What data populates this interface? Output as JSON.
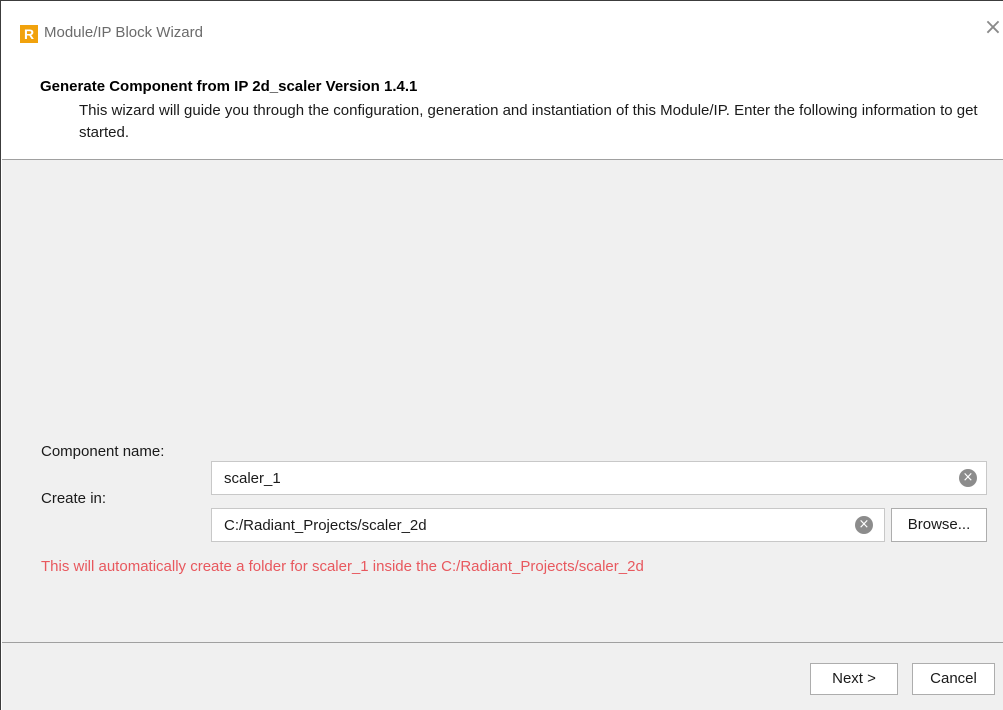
{
  "window": {
    "title": "Module/IP Block Wizard",
    "app_icon_letter": "R",
    "close_glyph": "×"
  },
  "header": {
    "title": "Generate Component from IP 2d_scaler Version 1.4.1",
    "description": "This wizard will guide you through the configuration, generation and instantiation of this Module/IP. Enter the following information to get started."
  },
  "form": {
    "component_name_label": "Component name:",
    "component_name_value": "scaler_1",
    "create_in_label": "Create in:",
    "create_in_value": "C:/Radiant_Projects/scaler_2d",
    "browse_label": "Browse...",
    "clear_glyph": "×",
    "info_message": "This will automatically create a folder for scaler_1 inside the C:/Radiant_Projects/scaler_2d"
  },
  "footer": {
    "next_label": "Next >",
    "cancel_label": "Cancel"
  },
  "colors": {
    "info_message": "#e8585e",
    "app_icon": "#f1a20c",
    "panel_background": "#f0f0f0"
  },
  "icons": [
    "radiant-app-icon",
    "close-icon",
    "clear-icon"
  ]
}
